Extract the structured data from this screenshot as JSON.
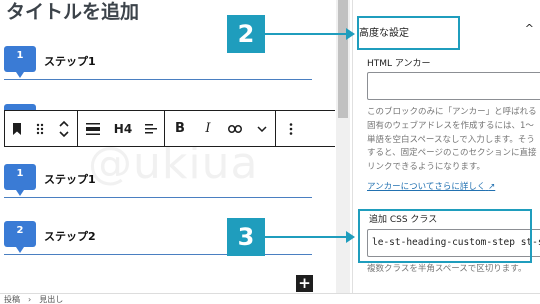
{
  "editor": {
    "title": "タイトルを追加",
    "watermark": "@ukiua",
    "steps": [
      {
        "number": "1",
        "label": "ステップ1"
      },
      {
        "number": "1",
        "label": "ステップ1"
      },
      {
        "number": "2",
        "label": "ステップ2"
      }
    ],
    "toolbar": {
      "heading_level": "H4"
    }
  },
  "sidebar": {
    "advanced_label": "高度な設定",
    "html_anchor_label": "HTML アンカー",
    "html_anchor_value": "",
    "help_lines": [
      "このブロックのみに「アンカー」と呼ばれる",
      "固有のウェブアドレスを作成するには、1〜",
      "単語を空白スペースなしで入力します。そう",
      "すると、固定ページのこのセクションに直接",
      "リンクできるようになります。"
    ],
    "anchor_link": "アンカーについてさらに詳しく",
    "css_class_label": "追加 CSS クラス",
    "css_class_value": "le-st-heading-custom-step st-step-reset",
    "css_help": "複数クラスを半角スペースで区切ります。"
  },
  "footer": {
    "crumbs": [
      "投稿",
      "見出し"
    ]
  },
  "callouts": {
    "advanced_number": "2",
    "css_number": "3"
  },
  "colors": {
    "accent": "#1f9dbd",
    "step_badge": "#3a7bd5",
    "link": "#2271b1"
  }
}
